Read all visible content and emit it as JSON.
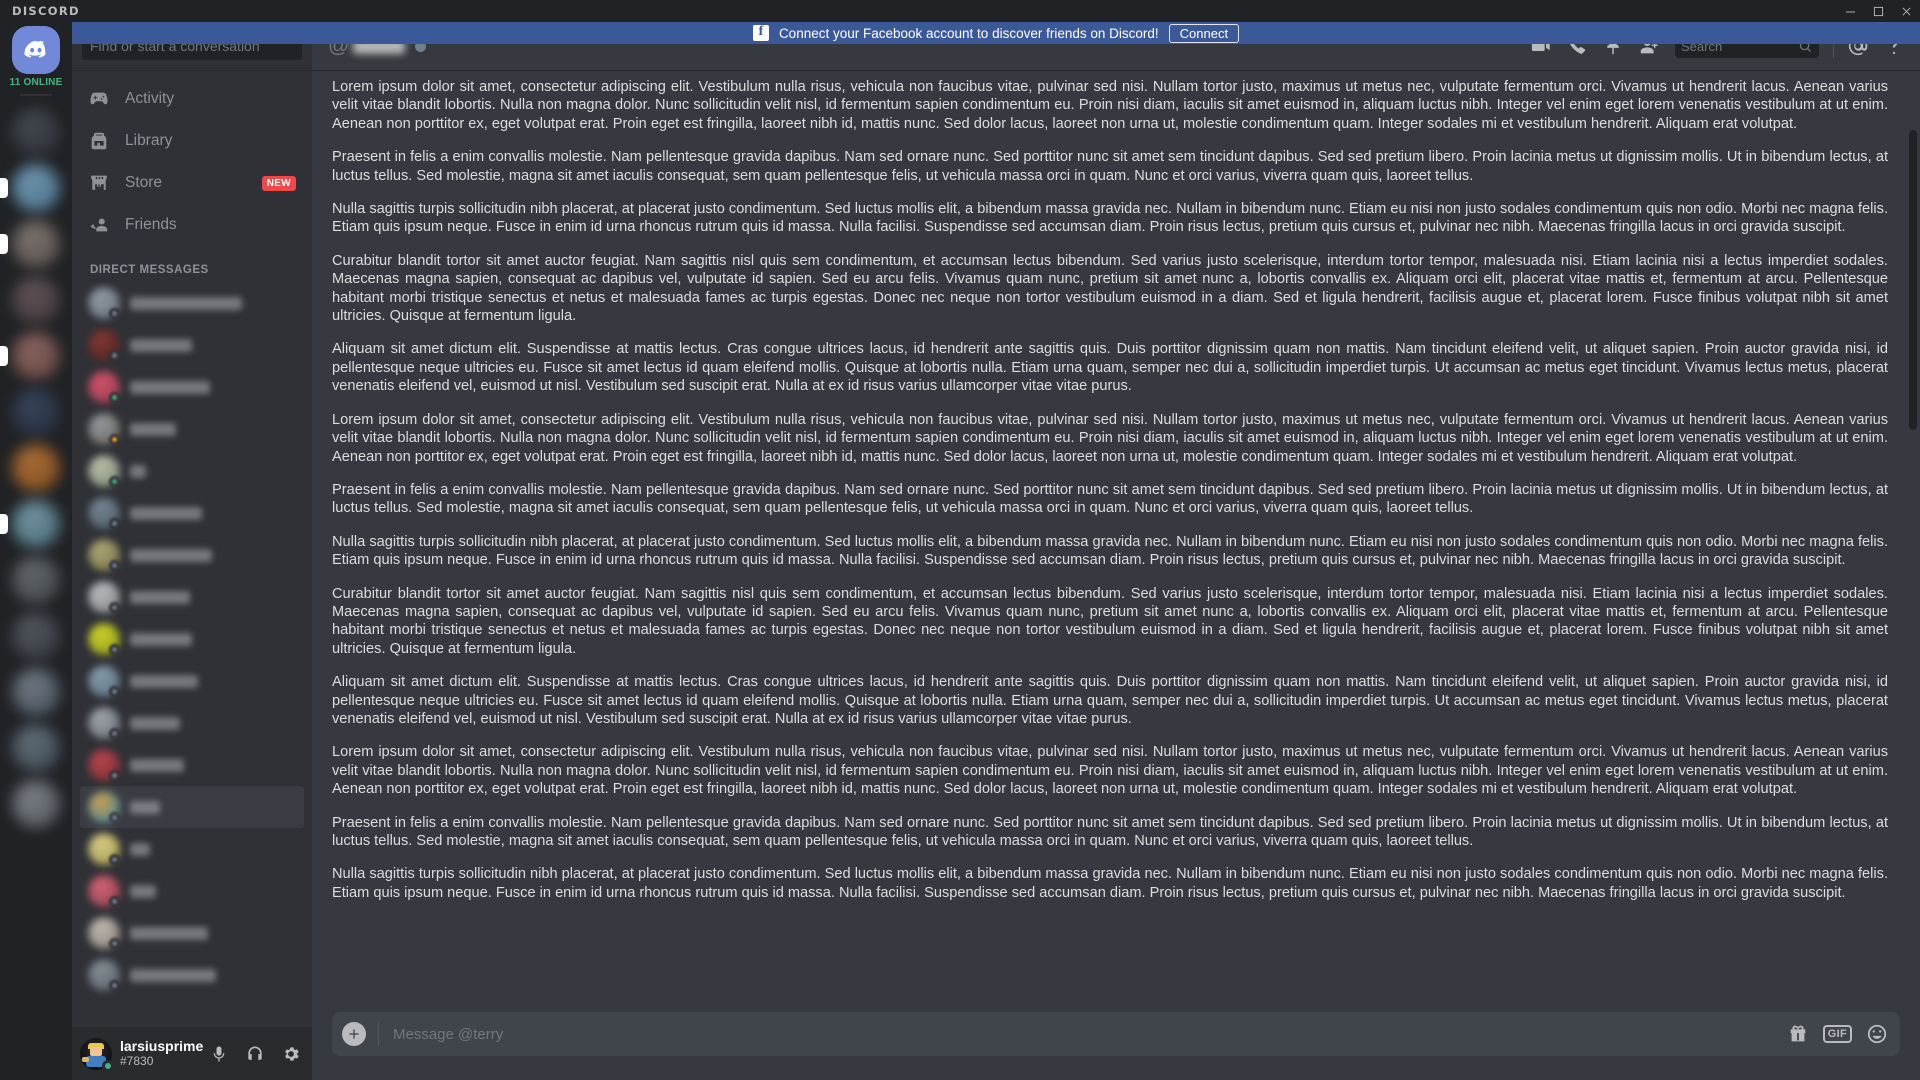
{
  "titlebar": {
    "brand": "DISCORD"
  },
  "banner": {
    "logo_text": "f",
    "message": "Connect your Facebook account to discover friends on Discord!",
    "button_label": "Connect"
  },
  "rail": {
    "home_tooltip": "Home",
    "online_count": "11 ONLINE",
    "servers": [
      {
        "color1": "#4a4f57",
        "color2": "#2e3238",
        "unread": false
      },
      {
        "color1": "#7ba7c4",
        "color2": "#4e7a96",
        "unread": true
      },
      {
        "color1": "#8b8079",
        "color2": "#5d544f",
        "unread": true
      },
      {
        "color1": "#6a5a5e",
        "color2": "#443a3e",
        "unread": false
      },
      {
        "color1": "#9b6f6a",
        "color2": "#6b4843",
        "unread": true
      },
      {
        "color1": "#3c4a63",
        "color2": "#252f42",
        "unread": false
      },
      {
        "color1": "#c07a3a",
        "color2": "#8a4f18",
        "unread": false
      },
      {
        "color1": "#7fa6b5",
        "color2": "#4c7585",
        "unread": true
      },
      {
        "color1": "#6e7378",
        "color2": "#43474b",
        "unread": false
      },
      {
        "color1": "#5a5f66",
        "color2": "#353940",
        "unread": false
      },
      {
        "color1": "#7d8894",
        "color2": "#4a535d",
        "unread": false
      },
      {
        "color1": "#6b7a86",
        "color2": "#3f4a54",
        "unread": false
      },
      {
        "color1": "#8a8f95",
        "color2": "#565b61",
        "unread": false
      }
    ]
  },
  "sidebar": {
    "search_placeholder": "Find or start a conversation",
    "nav_items": [
      {
        "label": "Activity",
        "icon": "gamepad-icon",
        "badge": ""
      },
      {
        "label": "Library",
        "icon": "backpack-icon",
        "badge": ""
      },
      {
        "label": "Store",
        "icon": "storefront-icon",
        "badge": "NEW"
      },
      {
        "label": "Friends",
        "icon": "friends-icon",
        "badge": ""
      }
    ],
    "dm_header": "DIRECT MESSAGES",
    "dms": [
      {
        "name_width": 112,
        "av1": "#9aa3ab",
        "av2": "#6a737c",
        "status": "#747f8d",
        "active": false
      },
      {
        "name_width": 62,
        "av1": "#8c3a35",
        "av2": "#4d1f1c",
        "status": "#747f8d",
        "active": false
      },
      {
        "name_width": 80,
        "av1": "#e0566f",
        "av2": "#9b3b52",
        "status": "#43b581",
        "active": false
      },
      {
        "name_width": 46,
        "av1": "#9ba4ac",
        "av2": "#6f6456",
        "status": "#faa61a",
        "active": false
      },
      {
        "name_width": 16,
        "av1": "#c9cbb4",
        "av2": "#7d8f7a",
        "status": "#43b581",
        "active": false
      },
      {
        "name_width": 72,
        "av1": "#7b8e9c",
        "av2": "#4d5c67",
        "status": "#747f8d",
        "active": false
      },
      {
        "name_width": 82,
        "av1": "#b8b27a",
        "av2": "#7d7747",
        "status": "#747f8d",
        "active": false
      },
      {
        "name_width": 60,
        "av1": "#c6c9cc",
        "av2": "#87898c",
        "status": "#747f8d",
        "active": false
      },
      {
        "name_width": 62,
        "av1": "#d8e02a",
        "av2": "#9aa015",
        "status": "#747f8d",
        "active": false
      },
      {
        "name_width": 68,
        "av1": "#8fa6b5",
        "av2": "#5a7383",
        "status": "#747f8d",
        "active": false
      },
      {
        "name_width": 50,
        "av1": "#a9b0b6",
        "av2": "#6d7479",
        "status": "#747f8d",
        "active": false
      },
      {
        "name_width": 54,
        "av1": "#c2484f",
        "av2": "#7e2b31",
        "status": "#747f8d",
        "active": false
      },
      {
        "name_width": 30,
        "av1": "#e0a84e",
        "av2": "#2b8cb5",
        "status": "#747f8d",
        "active": true
      },
      {
        "name_width": 20,
        "av1": "#e8dc8c",
        "av2": "#a89f4e",
        "status": "#747f8d",
        "active": false
      },
      {
        "name_width": 26,
        "av1": "#e06a7a",
        "av2": "#9c3d4d",
        "status": "#747f8d",
        "active": false
      },
      {
        "name_width": 78,
        "av1": "#cfc6bd",
        "av2": "#8d8279",
        "status": "#747f8d",
        "active": false
      },
      {
        "name_width": 86,
        "av1": "#8f98a0",
        "av2": "#5a6268",
        "status": "#747f8d",
        "active": false
      }
    ]
  },
  "user_panel": {
    "username": "larsiusprime",
    "discriminator": "#7830",
    "status_color": "#43b581",
    "buttons": [
      {
        "icon": "microphone-icon",
        "label": "Mute"
      },
      {
        "icon": "headphones-icon",
        "label": "Deafen"
      },
      {
        "icon": "gear-icon",
        "label": "User Settings"
      }
    ]
  },
  "chat_header": {
    "at_symbol": "@",
    "recipient_hidden": true,
    "status_color": "#747f8d",
    "icons": [
      {
        "icon": "video-call-icon",
        "label": "Start Video Call"
      },
      {
        "icon": "voice-call-icon",
        "label": "Start Voice Call"
      },
      {
        "icon": "pin-icon",
        "label": "Pinned Messages"
      },
      {
        "icon": "add-friend-icon",
        "label": "Add Friends to DM"
      }
    ],
    "search_placeholder": "Search",
    "right_icons": [
      {
        "icon": "mentions-icon",
        "label": "Inbox"
      },
      {
        "icon": "help-icon",
        "label": "Help"
      }
    ]
  },
  "messages": [
    " Lorem ipsum dolor sit amet, consectetur adipiscing elit. Vestibulum nulla risus, vehicula non faucibus vitae, pulvinar sed nisi. Nullam tortor justo, maximus ut metus nec, vulputate fermentum orci. Vivamus ut hendrerit lacus. Aenean varius velit vitae blandit lobortis. Nulla non magna dolor. Nunc sollicitudin velit nisl, id fermentum sapien condimentum eu. Proin nisi diam, iaculis sit amet euismod in, aliquam luctus nibh. Integer vel enim eget lorem venenatis vestibulum at ut enim. Aenean non porttitor ex, eget volutpat erat. Proin eget est fringilla, laoreet nibh id, mattis nunc. Sed dolor lacus, laoreet non urna ut, molestie condimentum quam. Integer sodales mi et vestibulum hendrerit. Aliquam erat volutpat.",
    "Praesent in felis a enim convallis molestie. Nam pellentesque gravida dapibus. Nam sed ornare nunc. Sed porttitor nunc sit amet sem tincidunt dapibus. Sed sed pretium libero. Proin lacinia metus ut dignissim mollis. Ut in bibendum lectus, at luctus tellus. Sed molestie, magna sit amet iaculis consequat, sem quam pellentesque felis, ut vehicula massa orci in quam. Nunc et orci varius, viverra quam quis, laoreet tellus.",
    "Nulla sagittis turpis sollicitudin nibh placerat, at placerat justo condimentum. Sed luctus mollis elit, a bibendum massa gravida nec. Nullam in bibendum nunc. Etiam eu nisi non justo sodales condimentum quis non odio. Morbi nec magna felis. Etiam quis ipsum neque. Fusce in enim id urna rhoncus rutrum quis id massa. Nulla facilisi. Suspendisse sed accumsan diam. Proin risus lectus, pretium quis cursus et, pulvinar nec nibh. Maecenas fringilla lacus in orci gravida suscipit.",
    "Curabitur blandit tortor sit amet auctor feugiat. Nam sagittis nisl quis sem condimentum, et accumsan lectus bibendum. Sed varius justo scelerisque, interdum tortor tempor, malesuada nisi. Etiam lacinia nisi a lectus imperdiet sodales. Maecenas magna sapien, consequat ac dapibus vel, vulputate id sapien. Sed eu arcu felis. Vivamus quam nunc, pretium sit amet nunc a, lobortis convallis ex. Aliquam orci elit, placerat vitae mattis et, fermentum at arcu. Pellentesque habitant morbi tristique senectus et netus et malesuada fames ac turpis egestas. Donec nec neque non tortor vestibulum euismod in a diam. Sed et ligula hendrerit, facilisis augue et, placerat lorem. Fusce finibus volutpat nibh sit amet ultricies. Quisque at fermentum ligula.",
    "Aliquam sit amet dictum elit. Suspendisse at mattis lectus. Cras congue ultrices lacus, id hendrerit ante sagittis quis. Duis porttitor dignissim quam non mattis. Nam tincidunt eleifend velit, ut aliquet sapien. Proin auctor gravida nisi, id pellentesque neque ultricies eu. Fusce sit amet lectus id quam eleifend mollis. Quisque at lobortis nulla. Etiam urna quam, semper nec dui a, sollicitudin imperdiet turpis. Ut accumsan ac metus eget tincidunt. Vivamus lectus metus, placerat venenatis eleifend vel, euismod ut nisl. Vestibulum sed suscipit erat. Nulla at ex id risus varius ullamcorper vitae vitae purus.",
    " Lorem ipsum dolor sit amet, consectetur adipiscing elit. Vestibulum nulla risus, vehicula non faucibus vitae, pulvinar sed nisi. Nullam tortor justo, maximus ut metus nec, vulputate fermentum orci. Vivamus ut hendrerit lacus. Aenean varius velit vitae blandit lobortis. Nulla non magna dolor. Nunc sollicitudin velit nisl, id fermentum sapien condimentum eu. Proin nisi diam, iaculis sit amet euismod in, aliquam luctus nibh. Integer vel enim eget lorem venenatis vestibulum at ut enim. Aenean non porttitor ex, eget volutpat erat. Proin eget est fringilla, laoreet nibh id, mattis nunc. Sed dolor lacus, laoreet non urna ut, molestie condimentum quam. Integer sodales mi et vestibulum hendrerit. Aliquam erat volutpat.",
    "Praesent in felis a enim convallis molestie. Nam pellentesque gravida dapibus. Nam sed ornare nunc. Sed porttitor nunc sit amet sem tincidunt dapibus. Sed sed pretium libero. Proin lacinia metus ut dignissim mollis. Ut in bibendum lectus, at luctus tellus. Sed molestie, magna sit amet iaculis consequat, sem quam pellentesque felis, ut vehicula massa orci in quam. Nunc et orci varius, viverra quam quis, laoreet tellus.",
    "Nulla sagittis turpis sollicitudin nibh placerat, at placerat justo condimentum. Sed luctus mollis elit, a bibendum massa gravida nec. Nullam in bibendum nunc. Etiam eu nisi non justo sodales condimentum quis non odio. Morbi nec magna felis. Etiam quis ipsum neque. Fusce in enim id urna rhoncus rutrum quis id massa. Nulla facilisi. Suspendisse sed accumsan diam. Proin risus lectus, pretium quis cursus et, pulvinar nec nibh. Maecenas fringilla lacus in orci gravida suscipit.",
    "Curabitur blandit tortor sit amet auctor feugiat. Nam sagittis nisl quis sem condimentum, et accumsan lectus bibendum. Sed varius justo scelerisque, interdum tortor tempor, malesuada nisi. Etiam lacinia nisi a lectus imperdiet sodales. Maecenas magna sapien, consequat ac dapibus vel, vulputate id sapien. Sed eu arcu felis. Vivamus quam nunc, pretium sit amet nunc a, lobortis convallis ex. Aliquam orci elit, placerat vitae mattis et, fermentum at arcu. Pellentesque habitant morbi tristique senectus et netus et malesuada fames ac turpis egestas. Donec nec neque non tortor vestibulum euismod in a diam. Sed et ligula hendrerit, facilisis augue et, placerat lorem. Fusce finibus volutpat nibh sit amet ultricies. Quisque at fermentum ligula.",
    "Aliquam sit amet dictum elit. Suspendisse at mattis lectus. Cras congue ultrices lacus, id hendrerit ante sagittis quis. Duis porttitor dignissim quam non mattis. Nam tincidunt eleifend velit, ut aliquet sapien. Proin auctor gravida nisi, id pellentesque neque ultricies eu. Fusce sit amet lectus id quam eleifend mollis. Quisque at lobortis nulla. Etiam urna quam, semper nec dui a, sollicitudin imperdiet turpis. Ut accumsan ac metus eget tincidunt. Vivamus lectus metus, placerat venenatis eleifend vel, euismod ut nisl. Vestibulum sed suscipit erat. Nulla at ex id risus varius ullamcorper vitae vitae purus.",
    " Lorem ipsum dolor sit amet, consectetur adipiscing elit. Vestibulum nulla risus, vehicula non faucibus vitae, pulvinar sed nisi. Nullam tortor justo, maximus ut metus nec, vulputate fermentum orci. Vivamus ut hendrerit lacus. Aenean varius velit vitae blandit lobortis. Nulla non magna dolor. Nunc sollicitudin velit nisl, id fermentum sapien condimentum eu. Proin nisi diam, iaculis sit amet euismod in, aliquam luctus nibh. Integer vel enim eget lorem venenatis vestibulum at ut enim. Aenean non porttitor ex, eget volutpat erat. Proin eget est fringilla, laoreet nibh id, mattis nunc. Sed dolor lacus, laoreet non urna ut, molestie condimentum quam. Integer sodales mi et vestibulum hendrerit. Aliquam erat volutpat.",
    "Praesent in felis a enim convallis molestie. Nam pellentesque gravida dapibus. Nam sed ornare nunc. Sed porttitor nunc sit amet sem tincidunt dapibus. Sed sed pretium libero. Proin lacinia metus ut dignissim mollis. Ut in bibendum lectus, at luctus tellus. Sed molestie, magna sit amet iaculis consequat, sem quam pellentesque felis, ut vehicula massa orci in quam. Nunc et orci varius, viverra quam quis, laoreet tellus.",
    "Nulla sagittis turpis sollicitudin nibh placerat, at placerat justo condimentum. Sed luctus mollis elit, a bibendum massa gravida nec. Nullam in bibendum nunc. Etiam eu nisi non justo sodales condimentum quis non odio. Morbi nec magna felis. Etiam quis ipsum neque. Fusce in enim id urna rhoncus rutrum quis id massa. Nulla facilisi. Suspendisse sed accumsan diam. Proin risus lectus, pretium quis cursus et, pulvinar nec nibh. Maecenas fringilla lacus in orci gravida suscipit."
  ],
  "input": {
    "placeholder": "Message @terry",
    "icons": [
      {
        "icon": "gift-icon",
        "label": "Send a gift"
      },
      {
        "icon": "gif-icon",
        "label": "GIF"
      },
      {
        "icon": "emoji-icon",
        "label": "Emoji"
      }
    ],
    "gif_label": "GIF"
  },
  "window_controls": [
    {
      "icon": "minimize-icon",
      "label": "Minimize"
    },
    {
      "icon": "maximize-icon",
      "label": "Maximize"
    },
    {
      "icon": "close-icon",
      "label": "Close"
    }
  ]
}
